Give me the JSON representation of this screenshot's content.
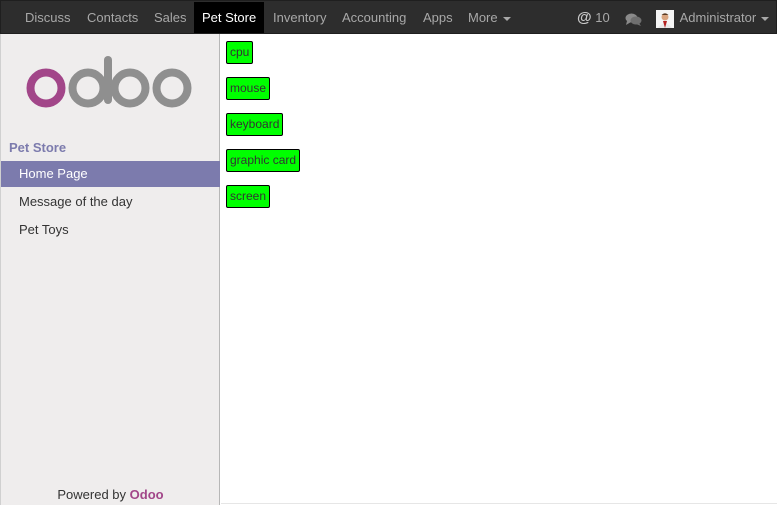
{
  "topbar": {
    "menu": [
      {
        "label": "Discuss",
        "active": false
      },
      {
        "label": "Contacts",
        "active": false
      },
      {
        "label": "Sales",
        "active": false
      },
      {
        "label": "Pet Store",
        "active": true
      },
      {
        "label": "Inventory",
        "active": false
      },
      {
        "label": "Accounting",
        "active": false
      },
      {
        "label": "Apps",
        "active": false
      },
      {
        "label": "More",
        "active": false
      }
    ],
    "mentions_count": "10",
    "user_name": "Administrator"
  },
  "sidebar": {
    "logo_text": "odoo",
    "section_title": "Pet Store",
    "items": [
      {
        "label": "Home Page",
        "active": true
      },
      {
        "label": "Message of the day",
        "active": false
      },
      {
        "label": "Pet Toys",
        "active": false
      }
    ],
    "footer_prefix": "Powered by",
    "footer_brand": "Odoo"
  },
  "content": {
    "tags": [
      "cpu",
      "mouse",
      "keyboard",
      "graphic card",
      "screen"
    ]
  },
  "colors": {
    "accent": "#7c7bad",
    "brand": "#a24689",
    "tag_bg": "#00ff00",
    "topbar_bg": "#2d2d2d"
  }
}
